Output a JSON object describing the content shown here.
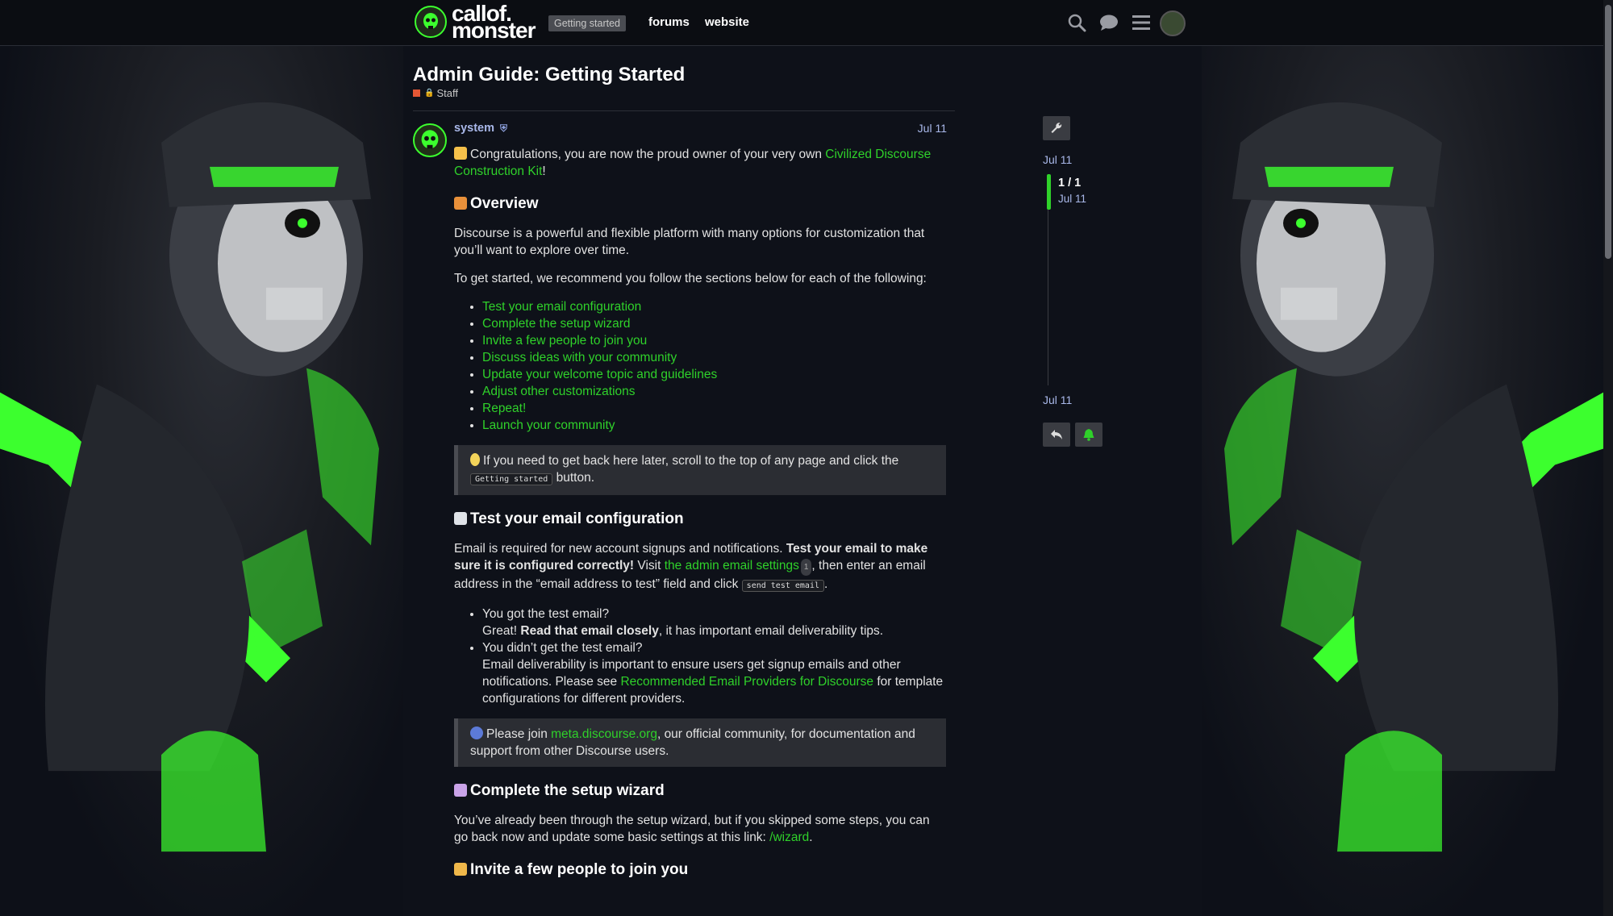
{
  "header": {
    "logo_line1": "callof.",
    "logo_line2": "monster",
    "getting_started_label": "Getting started",
    "nav": [
      "forums",
      "website"
    ],
    "icons": [
      "search-icon",
      "chat-icon",
      "hamburger-menu-icon",
      "user-avatar"
    ]
  },
  "topic": {
    "title": "Admin Guide: Getting Started",
    "category": "Staff",
    "category_color": "#e45735"
  },
  "post": {
    "username": "system",
    "date": "Jul 11",
    "intro_pre": "Congratulations, you are now the proud owner of your very own ",
    "intro_link": "Civilized Discourse Construction Kit",
    "intro_post": "!",
    "overview_heading": "Overview",
    "overview_p1": "Discourse is a powerful and flexible platform with many options for customization that you’ll want to explore over time.",
    "overview_p2": "To get started, we recommend you follow the sections below for each of the following:",
    "toc": [
      "Test your email configuration",
      "Complete the setup wizard",
      "Invite a few people to join you",
      "Discuss ideas with your community",
      "Update your welcome topic and guidelines",
      "Adjust other customizations",
      "Repeat!",
      "Launch your community"
    ],
    "callout1_pre": "If you need to get back here later, scroll to the top of any page and click the ",
    "callout1_code": "Getting started",
    "callout1_post": " button.",
    "email_heading": "Test your email configuration",
    "email_p_pre": "Email is required for new account signups and notifications. ",
    "email_p_bold": "Test your email to make sure it is configured correctly!",
    "email_p_mid": " Visit ",
    "email_p_link": "the admin email settings",
    "email_p_count": "1",
    "email_p_mid2": ", then enter an email address in the “email address to test” field and click ",
    "email_p_code": "send test email",
    "email_p_end": ".",
    "got_q": "You got the test email?",
    "got_a_pre": "Great! ",
    "got_a_bold": "Read that email closely",
    "got_a_post": ", it has important email deliverability tips.",
    "didnt_q": "You didn’t get the test email?",
    "didnt_a_pre": "Email deliverability is important to ensure users get signup emails and other notifications. Please see ",
    "didnt_a_link": "Recommended Email Providers for Discourse",
    "didnt_a_post": " for template configurations for different providers.",
    "callout2_pre": "Please join ",
    "callout2_link": "meta.discourse.org",
    "callout2_post": ", our official community, for documentation and support from other Discourse users.",
    "wizard_heading": "Complete the setup wizard",
    "wizard_p_pre": "You’ve already been through the setup wizard, but if you skipped some steps, you can go back now and update some basic settings at this link: ",
    "wizard_p_link": "/wizard",
    "wizard_p_end": ".",
    "invite_heading": "Invite a few people to join you"
  },
  "timeline": {
    "top_date": "Jul 11",
    "count": "1 / 1",
    "current_date": "Jul 11",
    "bottom_date": "Jul 11"
  },
  "colors": {
    "accent": "#2fd12a",
    "link_blue": "#a9b8e9"
  }
}
